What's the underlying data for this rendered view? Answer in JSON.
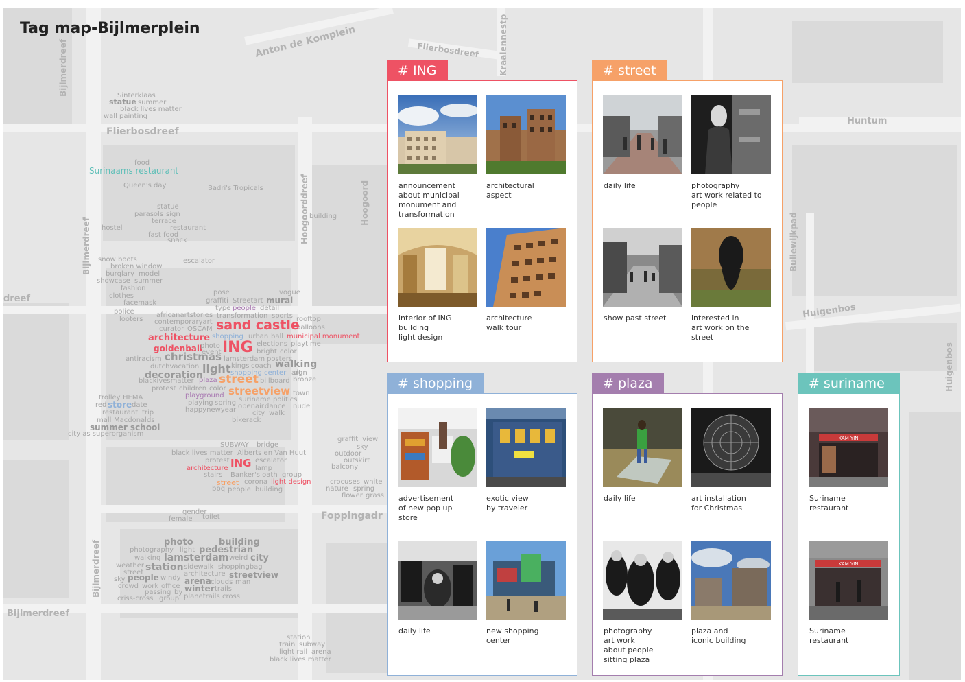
{
  "title": "Tag map-Bijlmerplein",
  "streets": {
    "anton_de_komplein": "Anton de Komplein",
    "fliersbosdreef_top": "Flierbosdreef",
    "kraaiennest": "Kraaiennestp",
    "fliersbosdreef": "Flierbosdreef",
    "bijlmerdreef_left": "Bijlmerdreef",
    "bijlmerdreef_mid": "Bijlmerdreef",
    "bijlmerdreef_low": "Bijlmerdreef",
    "bijlmerdreef_bottom": "Bijlmerdreef",
    "hoogoorddreef": "Hoogoorddreef",
    "hoogoord": "Hoogoord",
    "foppingadreef": "Foppingadr",
    "huntum": "Huntum",
    "bullewijkpad": "Bullewijkpad",
    "huigenbos": "Huigenbos",
    "huigenbos2": "Huigenbos",
    "dreef": "dreef"
  },
  "tags": [
    "Sinterklaas",
    "statue",
    "summer",
    "black lives matter",
    "wall painting",
    "food",
    "Surinaams restaurant",
    "Queen's day",
    "Badri's Tropicals",
    "statue",
    "parasols",
    "sign",
    "terrace",
    "restaurant",
    "hostel",
    "fast food",
    "snack",
    "building",
    "snow boots",
    "escalator",
    "broken window",
    "burglary",
    "model",
    "showcase",
    "summer",
    "fashion",
    "clothes",
    "facemask",
    "police",
    "looters",
    "pose",
    "vogue",
    "graffiti",
    "Streetart",
    "mural",
    "type",
    "people",
    "detail",
    "transformation",
    "sports",
    "rooftop",
    "africanartstories",
    "contemporaryart",
    "curator",
    "OSCAM",
    "balloons",
    "sand castle",
    "architecture",
    "shopping",
    "urban",
    "ball",
    "municipal monument",
    "elections",
    "playtime",
    "goldenball",
    "photo",
    "ING",
    "event",
    "bright",
    "color",
    "posters",
    "antiracism",
    "christmas",
    "lamsterdam",
    "walking",
    "dutchvacation",
    "kings",
    "coach",
    "light",
    "sign",
    "shopping center",
    "art",
    "blackivesmatter",
    "decoration",
    "plaza",
    "street",
    "billboard",
    "bronze",
    "protest",
    "children",
    "color",
    "streetview",
    "town",
    "playground",
    "suriname",
    "politics",
    "trolley",
    "HEMA",
    "playing",
    "spring",
    "openair",
    "dance",
    "nude",
    "red",
    "store",
    "date",
    "happynewyear",
    "city",
    "walk",
    "restaurant",
    "trip",
    "mall",
    "Macdonalds",
    "bikerack",
    "summer school",
    "city as superorganism",
    "SUBWAY",
    "bridge",
    "graffiti view",
    "sky",
    "black lives matter",
    "Alberts en Van Huut",
    "outdoor",
    "protest",
    "ING",
    "escalator",
    "outskirt",
    "architecture",
    "lamp",
    "balcony",
    "stairs",
    "Banker's oath",
    "group",
    "street",
    "corona",
    "light design",
    "crocuses",
    "white",
    "nature",
    "spring",
    "bbq",
    "people",
    "building",
    "flower",
    "grass",
    "gender",
    "female",
    "toilet",
    "photo",
    "building",
    "photography",
    "light",
    "pedestrian",
    "walking",
    "lamsterdam",
    "weird",
    "city",
    "weather",
    "station",
    "sidewalk",
    "shoppingbag",
    "street",
    "architecture",
    "streetview",
    "sky",
    "people",
    "windy",
    "arena",
    "clouds",
    "man",
    "crowd",
    "work",
    "office",
    "winter",
    "trails",
    "passing",
    "by",
    "criss-cross",
    "group",
    "planetrails",
    "cross",
    "station",
    "train",
    "subway",
    "light rail",
    "arena",
    "black lives matter"
  ],
  "panels": [
    {
      "name": "ING",
      "label": "# ING",
      "color": "#ee5264",
      "items": [
        {
          "caption": "announcement\nabout municipal\nmonument and\ntransformation"
        },
        {
          "caption": "architectural\naspect"
        },
        {
          "caption": "interior of ING\nbuilding\nlight design"
        },
        {
          "caption": "architecture\nwalk tour"
        }
      ]
    },
    {
      "name": "street",
      "label": "# street",
      "color": "#f6a168",
      "items": [
        {
          "caption": "daily life"
        },
        {
          "caption": "photography\nart work related to\npeople"
        },
        {
          "caption": "show past street"
        },
        {
          "caption": "interested in\nart work on the\nstreet"
        }
      ]
    },
    {
      "name": "shopping",
      "label": "# shopping",
      "color": "#8fb1d8",
      "items": [
        {
          "caption": "advertisement\nof new pop up\nstore"
        },
        {
          "caption": "exotic view\nby traveler"
        },
        {
          "caption": "daily life"
        },
        {
          "caption": "new shopping\ncenter"
        }
      ]
    },
    {
      "name": "plaza",
      "label": "# plaza",
      "color": "#a47eae",
      "items": [
        {
          "caption": "daily life"
        },
        {
          "caption": "art installation\nfor Christmas"
        },
        {
          "caption": "photography\nart work\nabout people\nsitting plaza"
        },
        {
          "caption": "plaza and\niconic building"
        }
      ]
    },
    {
      "name": "suriname",
      "label": "# suriname",
      "color": "#6cc4bc",
      "items": [
        {
          "caption": "Suriname\nrestaurant",
          "sign": "KAM YIN"
        },
        {
          "caption": "Suriname\nrestaurant",
          "sign": "KAM YIN"
        }
      ]
    }
  ]
}
